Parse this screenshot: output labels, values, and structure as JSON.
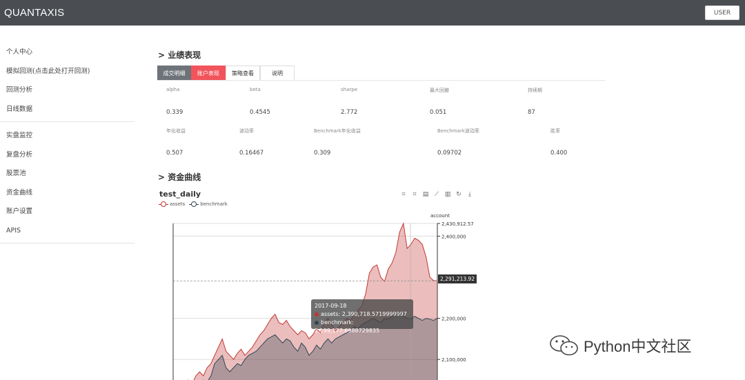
{
  "header": {
    "brand": "QUANTAXIS",
    "user_button": "USER"
  },
  "sidebar": {
    "group1": [
      "个人中心",
      "模拟回测(点击此处打开回测)",
      "回测分析",
      "日线数据"
    ],
    "group2": [
      "实盘监控",
      "复盘分析",
      "股票池",
      "资金曲线",
      "账户设置",
      "APIS"
    ]
  },
  "performance": {
    "title": "> 业绩表现",
    "tabs": [
      "成交明细",
      "账户表现",
      "策略查看",
      "说明"
    ],
    "row1": {
      "labels": [
        "alpha",
        "beta",
        "sharpe",
        "最大回撤",
        "持续期"
      ],
      "values": [
        "0.339",
        "0.4545",
        "2.772",
        "0.051",
        "87"
      ]
    },
    "row2": {
      "labels": [
        "年化收益",
        "波动率",
        "Benchmark年化收益",
        "Benchmark波动率",
        "胜率"
      ],
      "values": [
        "0.507",
        "0.16467",
        "0.309",
        "0.09702",
        "0.400"
      ]
    }
  },
  "equity": {
    "title": "> 资金曲线",
    "chart_title": "test_daily",
    "toolbox_icons": [
      "crop-icon",
      "crop-reset-icon",
      "data-view-icon",
      "line-chart-icon",
      "bar-chart-icon",
      "restore-icon",
      "download-icon"
    ]
  },
  "chart_data": {
    "type": "area",
    "title": "test_daily",
    "ylabel": "account",
    "ylim": [
      2050000,
      2430912.57
    ],
    "ymax_label": "2,430,912.57",
    "y_ticks": [
      "2,400,000",
      "2,200,000",
      "2,100,000"
    ],
    "y_tick_values": [
      2400000,
      2200000,
      2100000
    ],
    "pointer_label": "2,291,213.92",
    "pointer_value": 2291213.92,
    "legend_position": "top-left",
    "grid": true,
    "series": [
      {
        "name": "assets",
        "color": "#c23531",
        "values": [
          2020000,
          2030000,
          2050000,
          2040000,
          2060000,
          2070000,
          2060000,
          2080000,
          2090000,
          2110000,
          2130000,
          2150000,
          2120000,
          2110000,
          2100000,
          2115000,
          2125000,
          2110000,
          2120000,
          2130000,
          2145000,
          2160000,
          2170000,
          2185000,
          2200000,
          2210000,
          2190000,
          2185000,
          2195000,
          2180000,
          2170000,
          2160000,
          2170000,
          2165000,
          2150000,
          2160000,
          2175000,
          2165000,
          2190000,
          2200000,
          2185000,
          2170000,
          2180000,
          2190000,
          2200000,
          2195000,
          2210000,
          2220000,
          2230000,
          2260000,
          2310000,
          2325000,
          2330000,
          2300000,
          2290000,
          2320000,
          2335000,
          2360000,
          2410000,
          2430912,
          2370000,
          2380000,
          2395000,
          2390000,
          2380000,
          2350000,
          2300000,
          2292000,
          2291213
        ]
      },
      {
        "name": "benchmark",
        "color": "#2f4554",
        "values": [
          2020000,
          2025000,
          2020000,
          2030000,
          2035000,
          2040000,
          2050000,
          2045000,
          2060000,
          2090000,
          2100000,
          2110000,
          2080000,
          2070000,
          2080000,
          2090000,
          2085000,
          2100000,
          2110000,
          2115000,
          2120000,
          2130000,
          2140000,
          2150000,
          2155000,
          2160000,
          2150000,
          2140000,
          2150000,
          2145000,
          2130000,
          2120000,
          2140000,
          2130000,
          2110000,
          2120000,
          2135000,
          2125000,
          2140000,
          2150000,
          2140000,
          2150000,
          2155000,
          2160000,
          2165000,
          2170000,
          2180000,
          2175000,
          2185000,
          2190000,
          2195000,
          2200000,
          2195000,
          2190000,
          2200000,
          2198000,
          2205000,
          2210000,
          2215000,
          2205000,
          2200000,
          2199177,
          2205000,
          2200000,
          2195000,
          2200000,
          2198000,
          2195000,
          2200000
        ]
      }
    ],
    "tooltip": {
      "date": "2017-09-18",
      "rows": [
        "assets: 2,390,718.5719999997",
        "benchmark: 2,199,177.6988729835"
      ]
    }
  },
  "watermark": {
    "text": "Python中文社区"
  }
}
